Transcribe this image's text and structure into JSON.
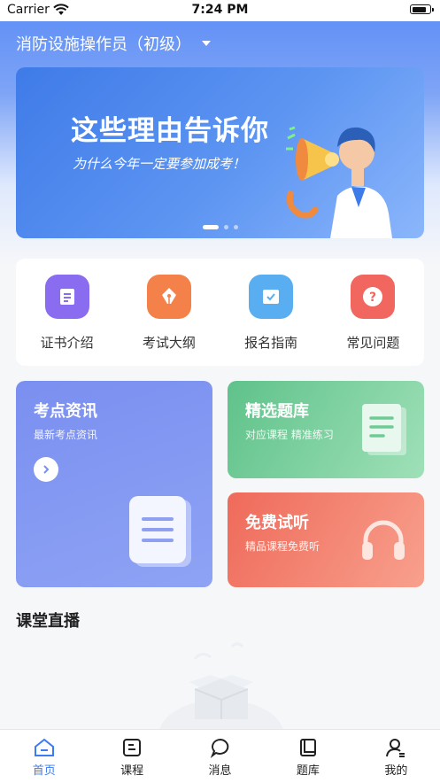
{
  "status": {
    "carrier": "Carrier",
    "time": "7:24 PM",
    "battery_level": 0.85
  },
  "header": {
    "title": "消防设施操作员（初级）"
  },
  "banner": {
    "title": "这些理由告诉你",
    "subtitle": "为什么今年一定要参加成考！",
    "page_count": 3,
    "active_index": 0
  },
  "quick": [
    {
      "label": "证书介绍",
      "icon": "certificate-icon",
      "color": "#8a6cf0"
    },
    {
      "label": "考试大纲",
      "icon": "pen-icon",
      "color": "#f5814a"
    },
    {
      "label": "报名指南",
      "icon": "checklist-icon",
      "color": "#58aef0"
    },
    {
      "label": "常见问题",
      "icon": "question-icon",
      "color": "#f26660"
    }
  ],
  "cards": {
    "news": {
      "title": "考点资讯",
      "subtitle": "最新考点资讯"
    },
    "bank": {
      "title": "精选题库",
      "subtitle": "对应课程 精准练习"
    },
    "trial": {
      "title": "免费试听",
      "subtitle": "精品课程免费听"
    }
  },
  "live": {
    "title": "课堂直播"
  },
  "tabs": [
    {
      "label": "首页",
      "icon": "home-icon",
      "active": true
    },
    {
      "label": "课程",
      "icon": "course-icon",
      "active": false
    },
    {
      "label": "消息",
      "icon": "message-icon",
      "active": false
    },
    {
      "label": "题库",
      "icon": "question-bank-icon",
      "active": false
    },
    {
      "label": "我的",
      "icon": "profile-icon",
      "active": false
    }
  ],
  "colors": {
    "accent": "#3c7bf1"
  }
}
